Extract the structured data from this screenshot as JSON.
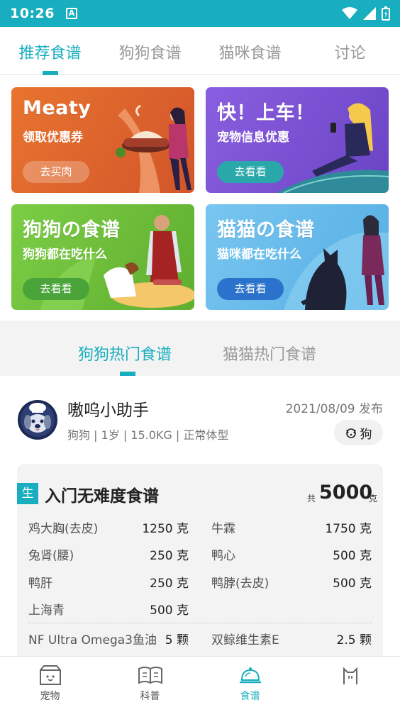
{
  "status_bar": {
    "time": "10:26",
    "app_icon_letter": "A"
  },
  "top_tabs": [
    {
      "label": "推荐食谱",
      "active": true
    },
    {
      "label": "狗狗食谱",
      "active": false
    },
    {
      "label": "猫咪食谱",
      "active": false
    },
    {
      "label": "讨论",
      "active": false
    }
  ],
  "banners": [
    {
      "title": "Meaty",
      "subtitle": "领取优惠券",
      "button": "去买肉",
      "bg": "#e06a2a"
    },
    {
      "title": "快！上车！",
      "subtitle": "宠物信息优惠",
      "button": "去看看",
      "bg": "#7a52d0"
    },
    {
      "title": "狗狗の食谱",
      "subtitle": "狗狗都在吃什么",
      "button": "去看看",
      "bg": "#6fbf3a"
    },
    {
      "title": "猫猫の食谱",
      "subtitle": "猫咪都在吃什么",
      "button": "去看看",
      "bg": "#5fb8ea"
    }
  ],
  "hot_tabs": [
    {
      "label": "狗狗热门食谱",
      "active": true
    },
    {
      "label": "猫猫热门食谱",
      "active": false
    }
  ],
  "post": {
    "author": "嗷呜小助手",
    "date": "2021/08/09 发布",
    "pet_info": "狗狗 | 1岁 | 15.0KG | 正常体型",
    "pet_chip": "狗",
    "badge": "生",
    "recipe_title": "入门无难度食谱",
    "total_prefix": "共",
    "total_value": "5000",
    "total_unit": "克",
    "ingredients": [
      {
        "name": "鸡大胸(去皮)",
        "amount": "1250 克"
      },
      {
        "name": "牛霖",
        "amount": "1750 克"
      },
      {
        "name": "兔肾(腰)",
        "amount": "250 克"
      },
      {
        "name": "鸭心",
        "amount": "500 克"
      },
      {
        "name": "鸭肝",
        "amount": "250 克"
      },
      {
        "name": "鸭脖(去皮)",
        "amount": "500 克"
      },
      {
        "name": "上海青",
        "amount": "500 克"
      }
    ],
    "supplements": [
      {
        "name": "NF Ultra Omega3鱼油",
        "amount": "5 颗"
      },
      {
        "name": "双鲸维生素E",
        "amount": "2.5 颗"
      }
    ]
  },
  "bottom_nav": [
    {
      "label": "宠物",
      "icon": "pet-box-icon",
      "active": false
    },
    {
      "label": "科普",
      "icon": "book-icon",
      "active": false
    },
    {
      "label": "食谱",
      "icon": "cloche-icon",
      "active": true
    },
    {
      "label": "",
      "icon": "cat-icon",
      "active": false
    }
  ],
  "colors": {
    "accent": "#19aebf",
    "inactive": "#999999"
  }
}
